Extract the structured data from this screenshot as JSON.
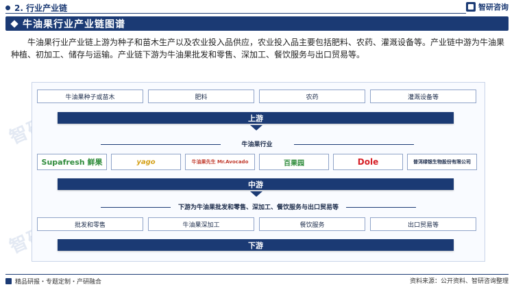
{
  "header": {
    "section_label": "2. 行业产业链",
    "logo_text": "智研咨询"
  },
  "banner": {
    "title": "牛油果行业产业链图谱"
  },
  "intro": "牛油果行业产业链上游为种子和苗木生产以及农业投入品供应，农业投入品主要包括肥料、农药、灌溉设备等。产业链中游为牛油果种植、初加工、储存与运输。产业链下游为牛油果批发和零售、深加工、餐饮服务与出口贸易等。",
  "upstream": {
    "items": [
      "牛油果种子或苗木",
      "肥料",
      "农药",
      "灌溉设备等"
    ],
    "stage_label": "上游"
  },
  "midstream": {
    "heading": "牛油果行业",
    "companies": [
      {
        "name": "Supafresh 鲜果",
        "color": "#2e8b3a"
      },
      {
        "name": "yago",
        "color": "#d4a017"
      },
      {
        "name": "牛油果先生 Mr.Avocado",
        "color": "#c0392b"
      },
      {
        "name": "百果园",
        "color": "#2e8b3a"
      },
      {
        "name": "Dole",
        "color": "#d61f26"
      },
      {
        "name": "普洱绿银生物股份有限公司",
        "color": "#1b2b4a"
      }
    ],
    "stage_label": "中游"
  },
  "downstream": {
    "heading": "下游为牛油果批发和零售、深加工、餐饮服务与出口贸易等",
    "items": [
      "批发和零售",
      "牛油果深加工",
      "餐饮服务",
      "出口贸易等"
    ],
    "stage_label": "下游"
  },
  "footer": {
    "left": "精品研报・专题定制・产研融合",
    "right": "资料来源：公开资料、智研咨询整理"
  },
  "colors": {
    "primary": "#1b3a74",
    "panel_border": "#c9d4e8"
  }
}
